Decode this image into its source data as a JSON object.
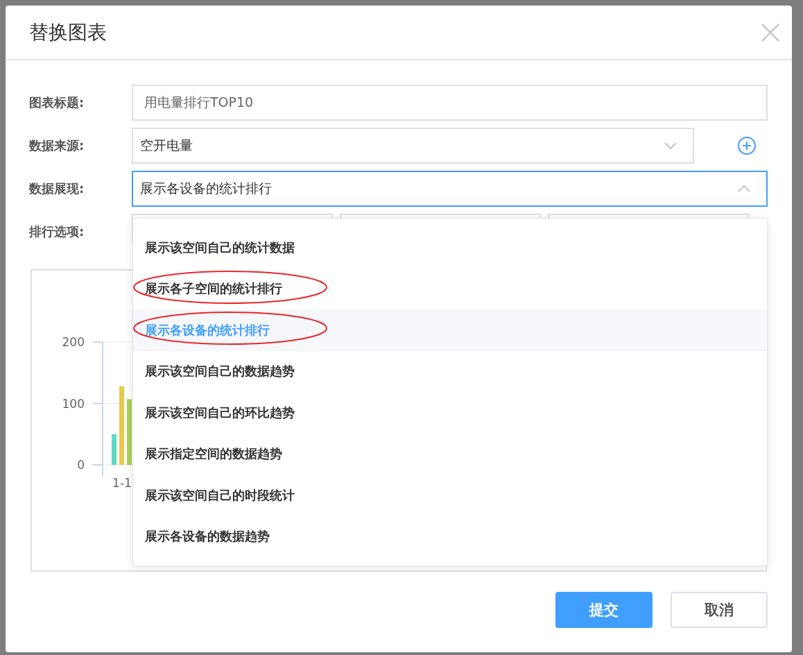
{
  "dialog": {
    "title": "替换图表"
  },
  "form": {
    "title_label": "图表标题:",
    "title_value": "用电量排行TOP10",
    "source_label": "数据来源:",
    "source_value": "空开电量",
    "display_label": "数据展现:",
    "display_value": "展示各设备的统计排行",
    "display_expanded": true,
    "rank_label": "排行选项:"
  },
  "dropdown_items": [
    {
      "label": "展示该空间自己的统计数据",
      "selected": false,
      "circled": false
    },
    {
      "label": "展示各子空间的统计排行",
      "selected": false,
      "circled": true
    },
    {
      "label": "展示各设备的统计排行",
      "selected": true,
      "circled": true
    },
    {
      "label": "展示该空间自己的数据趋势",
      "selected": false,
      "circled": false
    },
    {
      "label": "展示该空间自己的环比趋势",
      "selected": false,
      "circled": false
    },
    {
      "label": "展示指定空间的数据趋势",
      "selected": false,
      "circled": false
    },
    {
      "label": "展示该空间自己的时段统计",
      "selected": false,
      "circled": false
    },
    {
      "label": "展示各设备的数据趋势",
      "selected": false,
      "circled": false
    }
  ],
  "preview": {
    "chart_data": {
      "type": "bar",
      "categories": [
        "1-1"
      ],
      "series": [
        {
          "color": "#5dd9c4",
          "values": [
            50
          ]
        },
        {
          "color": "#e8c94c",
          "values": [
            128
          ]
        },
        {
          "color": "#a9d15a",
          "values": [
            107
          ]
        }
      ],
      "ylim": [
        0,
        200
      ],
      "yticks": [
        0,
        100,
        200
      ]
    }
  },
  "buttons": [
    {
      "label": "提交",
      "kind": "primary"
    },
    {
      "label": "取消",
      "kind": "default"
    }
  ]
}
